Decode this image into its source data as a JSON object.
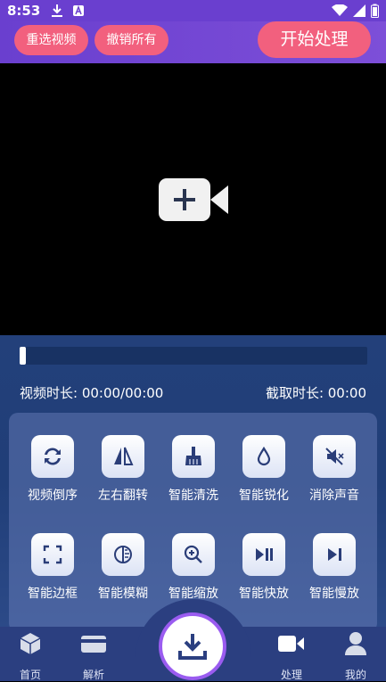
{
  "status_bar": {
    "time": "8:53"
  },
  "header": {
    "reselect_label": "重选视频",
    "undo_label": "撤销所有",
    "start_label": "开始处理"
  },
  "video": {
    "duration_text": "视频时长: 00:00/00:00",
    "clip_text": "截取时长: 00:00",
    "progress": 0
  },
  "tools": [
    {
      "label": "视频倒序",
      "icon": "reverse-icon"
    },
    {
      "label": "左右翻转",
      "icon": "flip-icon"
    },
    {
      "label": "智能清洗",
      "icon": "broom-icon"
    },
    {
      "label": "智能锐化",
      "icon": "droplet-icon"
    },
    {
      "label": "消除声音",
      "icon": "mute-icon"
    },
    {
      "label": "智能边框",
      "icon": "frame-icon"
    },
    {
      "label": "智能模糊",
      "icon": "blur-icon"
    },
    {
      "label": "智能缩放",
      "icon": "zoom-icon"
    },
    {
      "label": "智能快放",
      "icon": "fast-play-icon"
    },
    {
      "label": "智能慢放",
      "icon": "slow-play-icon"
    }
  ],
  "bottom_nav": {
    "items": [
      {
        "label": "首页",
        "icon": "home-cube-icon"
      },
      {
        "label": "解析",
        "icon": "parse-card-icon"
      },
      {
        "label": "处理",
        "icon": "video-camera-icon"
      },
      {
        "label": "我的",
        "icon": "user-icon"
      }
    ],
    "center_icon": "download-icon"
  },
  "colors": {
    "header_purple": "#6a3fcf",
    "pill_pink": "#f2607e",
    "panel_blue": "#23407a",
    "center_ring": "#9a5cf0"
  }
}
